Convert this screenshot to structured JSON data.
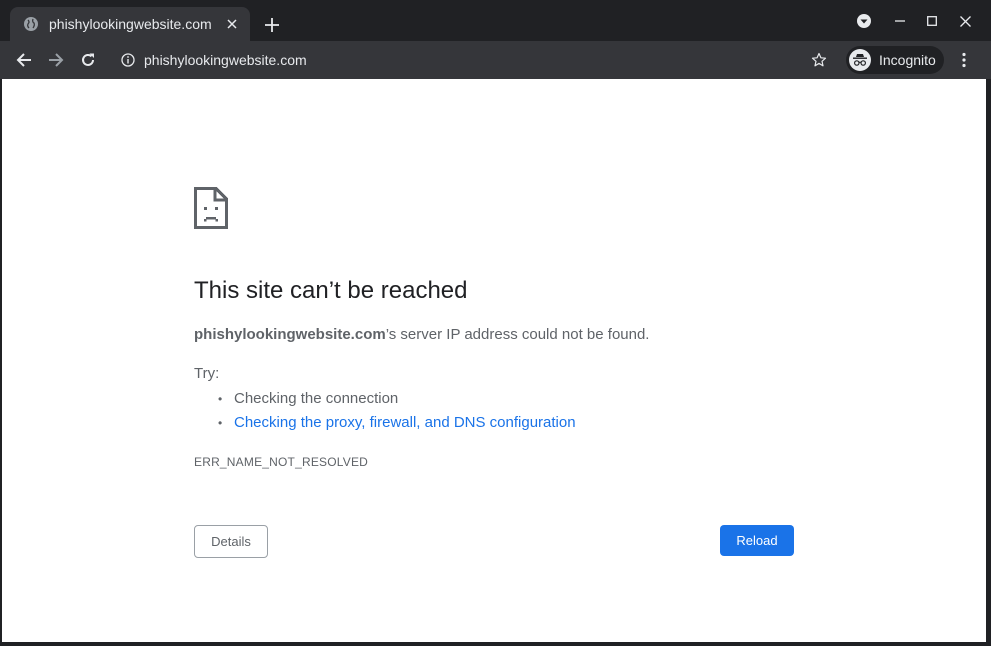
{
  "tab": {
    "title": "phishylookingwebsite.com",
    "favicon": "globe-icon"
  },
  "toolbar": {
    "url": "phishylookingwebsite.com",
    "incognito_label": "Incognito"
  },
  "error": {
    "heading": "This site can’t be reached",
    "domain": "phishylookingwebsite.com",
    "message_suffix": "’s server IP address could not be found.",
    "try_label": "Try:",
    "suggestions": [
      {
        "text": "Checking the connection",
        "is_link": false
      },
      {
        "text": "Checking the proxy, firewall, and DNS configuration",
        "is_link": true
      }
    ],
    "code": "ERR_NAME_NOT_RESOLVED"
  },
  "buttons": {
    "details": "Details",
    "reload": "Reload"
  },
  "colors": {
    "chrome_dark": "#202124",
    "toolbar": "#35363a",
    "link": "#1a73e8",
    "primary_button": "#1a73e8"
  }
}
